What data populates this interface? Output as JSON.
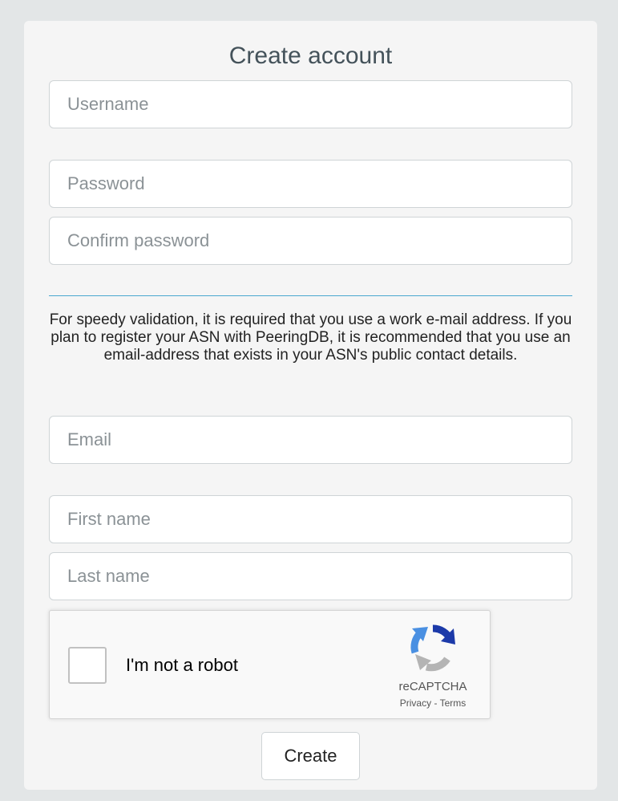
{
  "form": {
    "title": "Create account",
    "username_placeholder": "Username",
    "password_placeholder": "Password",
    "confirm_password_placeholder": "Confirm password",
    "email_notice": "For speedy validation, it is required that you use a work e-mail address. If you plan to register your ASN with PeeringDB, it is recommended that you use an email-address that exists in your ASN's public contact details.",
    "email_placeholder": "Email",
    "first_name_placeholder": "First name",
    "last_name_placeholder": "Last name",
    "submit_label": "Create"
  },
  "captcha": {
    "label": "I'm not a robot",
    "brand": "reCAPTCHA",
    "privacy_label": "Privacy",
    "separator": " - ",
    "terms_label": "Terms",
    "logo_icon": "recaptcha-logo-icon",
    "colors": {
      "blue": "#1c3aa9",
      "light_blue": "#4a90e2",
      "grey": "#b4b4b4"
    }
  },
  "colors": {
    "background": "#e3e6e7",
    "card": "#f5f5f5",
    "divider": "#4aa8cf",
    "title": "#44525a"
  }
}
